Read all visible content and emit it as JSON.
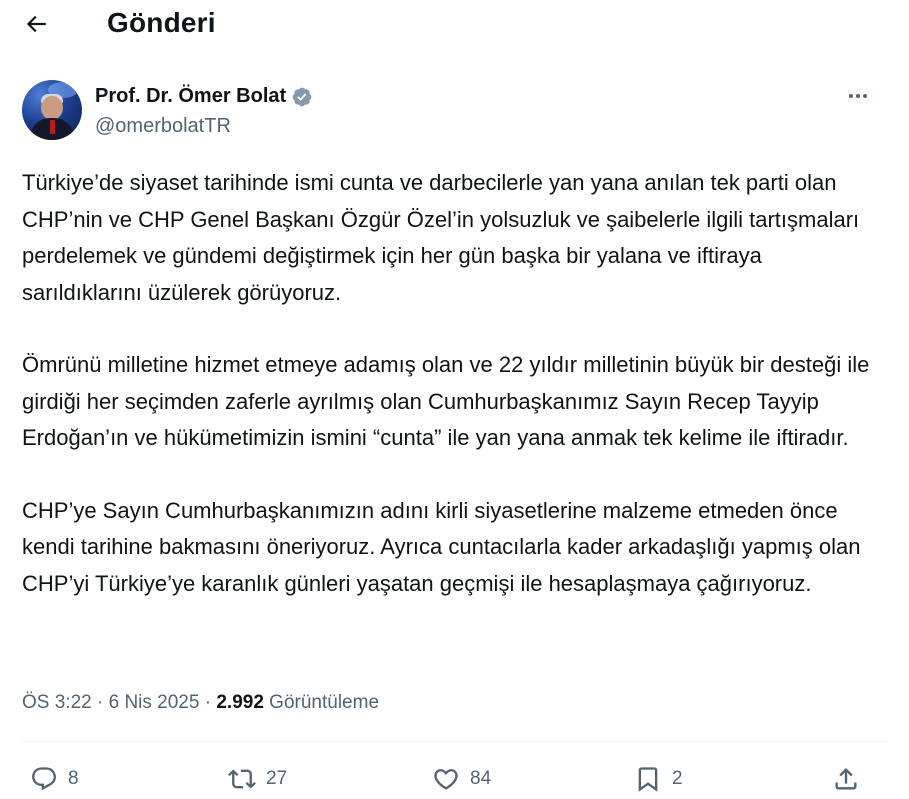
{
  "header": {
    "title": "Gönderi",
    "back_icon": "arrow-left-icon"
  },
  "author": {
    "display_name": "Prof. Dr. Ömer Bolat",
    "handle": "@omerbolatTR",
    "verified_color": "#829aab"
  },
  "tweet": {
    "paragraphs": [
      "Türkiye’de siyaset tarihinde ismi cunta ve darbecilerle yan yana anılan tek parti olan CHP’nin ve CHP Genel Başkanı Özgür Özel’in yolsuzluk ve şaibelerle ilgili tartışmaları perdelemek ve gündemi değiştirmek için her gün başka bir yalana ve iftiraya sarıldıklarını üzülerek görüyoruz.",
      "Ömrünü milletine hizmet etmeye adamış olan ve 22 yıldır milletinin büyük bir desteği ile girdiği her seçimden zaferle ayrılmış olan Cumhurbaşkanımız Sayın Recep Tayyip Erdoğan’ın ve hükümetimizin ismini “cunta” ile yan yana anmak tek kelime ile iftiradır.",
      "CHP’ye Sayın Cumhurbaşkanımızın adını kirli siyasetlerine malzeme etmeden önce kendi tarihine bakmasını öneriyoruz. Ayrıca cuntacılarla kader arkadaşlığı yapmış olan CHP’yi Türkiye’ye karanlık günleri yaşatan geçmişi ile hesaplaşmaya çağırıyoruz."
    ],
    "time": "ÖS 3:22",
    "separator": "·",
    "date": "6 Nis 2025",
    "views_count": "2.992",
    "views_label": "Görüntüleme"
  },
  "actions": {
    "reply_count": "8",
    "retweet_count": "27",
    "like_count": "84",
    "bookmark_count": "2"
  },
  "colors": {
    "text": "#0f1419",
    "secondary": "#536471",
    "divider": "#eff3f4"
  }
}
